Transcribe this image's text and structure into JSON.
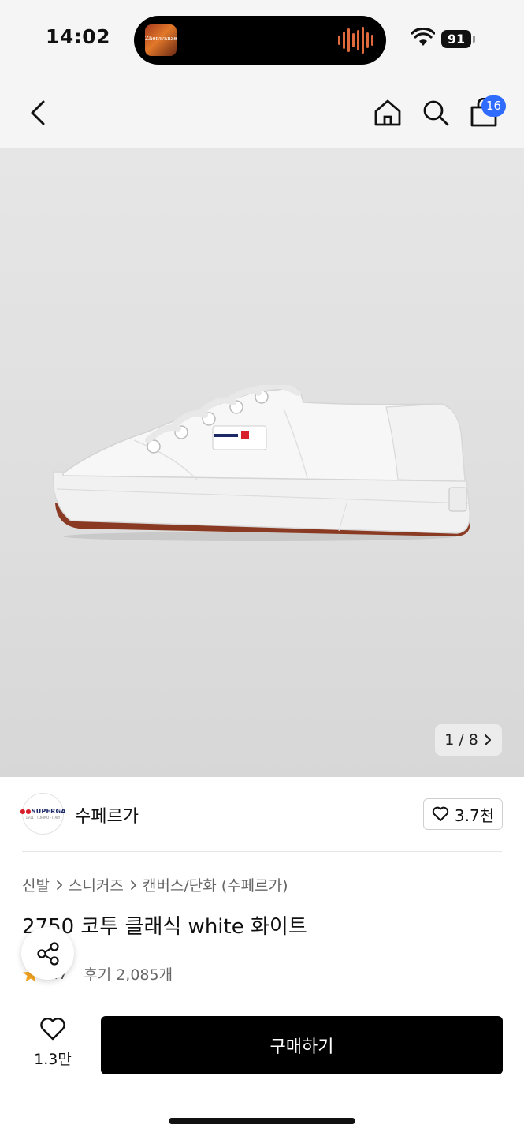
{
  "status_bar": {
    "time": "14:02",
    "now_playing_label": "Zhenwanzen",
    "battery": "91"
  },
  "header": {
    "back_icon": "chevron-left-icon",
    "home_icon": "home-icon",
    "search_icon": "search-icon",
    "cart_icon": "shopping-bag-icon",
    "cart_count": "16",
    "badge_color": "#2f6bff"
  },
  "gallery": {
    "current": "1",
    "separator": "/",
    "total": "8"
  },
  "brand": {
    "logo_text": "SUPERGA",
    "logo_sub": "1911 · TORINO · ITALY",
    "name": "수페르가",
    "like_count": "3.7천"
  },
  "breadcrumb": {
    "items": [
      "신발",
      "스니커즈",
      "캔버스/단화 (수페르가)"
    ]
  },
  "product": {
    "title": "2750 코투 클래식 white 화이트",
    "rating": "4.7",
    "reviews": "후기 2,085개"
  },
  "bottom_bar": {
    "wishlist_count": "1.3만",
    "buy_label": "구매하기"
  }
}
